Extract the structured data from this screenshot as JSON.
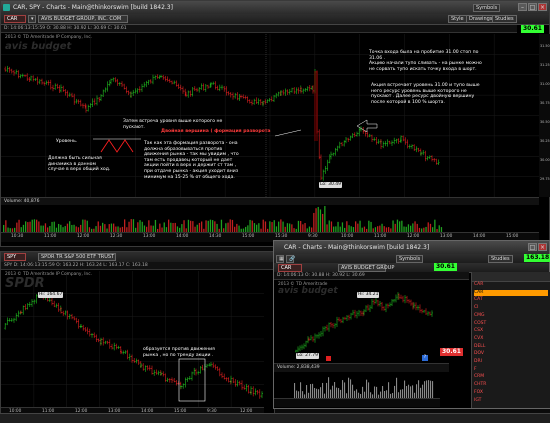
{
  "top_window": {
    "title": "CAR, SPY - Charts - Main@thinkorswim [build 1842.3]",
    "symbol": "CAR",
    "quote_line": "AVIS BUDGET GROUP, INC. COM",
    "toolbar_buttons": [
      "Style",
      "Drawings",
      "Studies"
    ],
    "symbols_button": "Symbols",
    "last_price": "30.61",
    "ohlc": "D: 14:06:13:15:59  O: 30.88  H: 30.92  L: 30.69  C: 30.61",
    "copyright": "2013 © TD Ameritrade IP Company, Inc.",
    "watermark": "avis budget",
    "price_labels": [
      "31.50",
      "31.25",
      "31.00",
      "30.75",
      "30.50",
      "30.25",
      "30.00",
      "29.75"
    ],
    "time_labels": [
      "10:30",
      "11:00",
      "12:00",
      "12:30",
      "13:00",
      "14:00",
      "14:30",
      "15:00",
      "15:30",
      "9:30",
      "10:00",
      "11:00",
      "12:00",
      "13:00",
      "14:00",
      "15:00"
    ],
    "low_label": "Lo: 30.49",
    "volume_label": "Volume: 40,876",
    "annotations": {
      "level": "Уровень.",
      "should_be_strong": "Должна быть сильная\nдинамика в данном\nслучае в верх общий ход.",
      "then_meeting": "Затем встреча уровня  выше которого не\nпускают.",
      "double_top_title": "Двойная вершина ( формация разворота",
      "double_top_body": "Так как эта формация разворота - она\nдолжна образовываться против\nдвижения рынка - так мы увидим , что\nтам есть продавец который не дает\nакции пойти в верх и держит ст там ,\nпри отдаче рынка - акция уходит вниз\nминимум на 15-25 % от общего хода.",
      "entry_point": "Точка входа была на пробитие 31.00 стоп по\n31.06 .\nАкцию начали тупо сливать - на рынке можно\nне сорвать  тупо искать точку входа в шорт.",
      "meets_level": "Акция встречает уровень 31.00 и тупо выше\nнего ресурс уровень выше которого не\nпускают . Далее ресурс двойную вершину\nпосле которой в 100 % шорта."
    }
  },
  "bottom_window": {
    "symbol": "SPY",
    "quote_line": "SPDR TR S&P 500 ETF TRUST",
    "ohlc": "SPY D: 14:06:13:15:59  O: 163.22  H: 163.24  L: 163.17  C: 163.18",
    "copyright": "2013 © TD Ameritrade IP Company, Inc.",
    "watermark": "SPDR",
    "high_label": "Hi: 164.67",
    "annotation": "образуется против движения\nрынка , но по тренду акции .",
    "price_labels": [
      "164.50",
      "164.00",
      "163.50",
      "163.00",
      "162.50"
    ],
    "time_labels": [
      "10:00",
      "11:00",
      "12:00",
      "13:00",
      "14:00",
      "15:00",
      "9:30",
      "12:00"
    ]
  },
  "popup_window": {
    "title": "CAR - Charts - Main@thinkorswim [build 1842.3]",
    "symbol": "CAR",
    "quote_line": "AVIS BUDGET GROUP",
    "symbols_button": "Symbols",
    "last_price": "30.61",
    "ohlc": "D: 14:06:13  O: 30.88  H: 30.92  L: 30.69",
    "copyright": "2013 © TD Ameritrade",
    "watermark": "avis budget",
    "high_label": "Hi: 34.21",
    "low_label": "Lo: 27.79",
    "volume_label": "Volume: 2,838,439",
    "studies_button": "Studies",
    "right_price": "163.18",
    "right_price_alt": "30.61",
    "watchlist": [
      "CAR",
      "CAR",
      "CAT",
      "CI",
      "CMG",
      "COST",
      "CSX",
      "CVX",
      "DELL",
      "DOV",
      "DRI",
      "F",
      "CRM",
      "CHTR",
      "FOX",
      "IGT"
    ]
  },
  "colors": {
    "up": "#20c020",
    "down": "#e02020",
    "price_green": "#33ff33",
    "price_red": "#e03030",
    "accent_orange": "#ff9a00"
  }
}
